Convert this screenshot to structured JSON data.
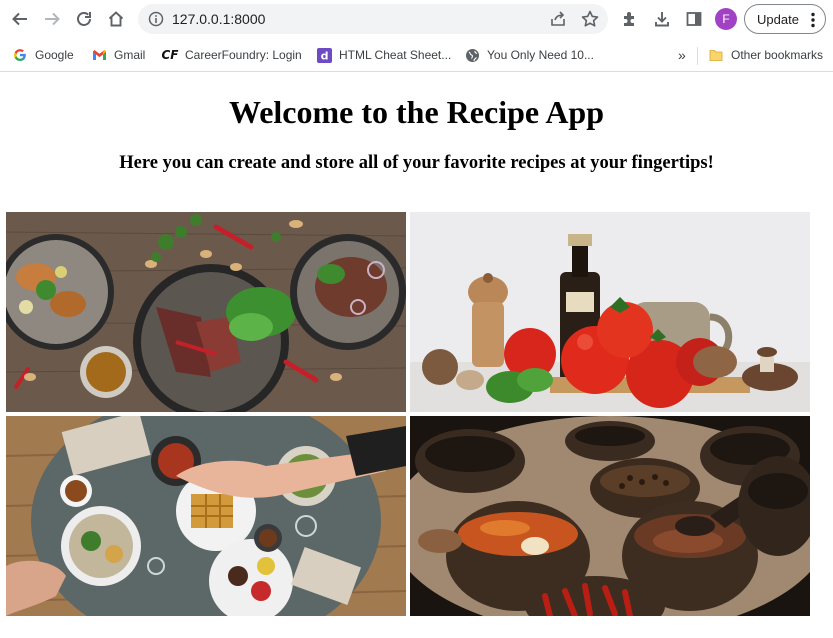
{
  "browser": {
    "url": "127.0.0.1:8000",
    "update_label": "Update",
    "profile_initial": "F",
    "icons": [
      "back-icon",
      "forward-icon",
      "reload-icon",
      "home-icon",
      "info-icon",
      "share-icon",
      "star-icon",
      "extensions-icon",
      "download-icon",
      "sidepanel-icon",
      "menu-icon"
    ]
  },
  "bookmarks": {
    "items": [
      {
        "label": "Google",
        "icon": "google-icon"
      },
      {
        "label": "Gmail",
        "icon": "gmail-icon"
      },
      {
        "label": "CareerFoundry: Login",
        "icon": "careerfoundry-icon"
      },
      {
        "label": "HTML Cheat Sheet...",
        "icon": "devhints-icon"
      },
      {
        "label": "You Only Need 10...",
        "icon": "globe-icon"
      }
    ],
    "overflow_label": "»",
    "other_label": "Other bookmarks"
  },
  "page": {
    "title": "Welcome to the Recipe App",
    "subtitle": "Here you can create and store all of your favorite recipes at your fingertips!",
    "images": [
      "food-plates-image",
      "tomatoes-vinegar-image",
      "dining-table-image",
      "spice-bowls-image"
    ]
  }
}
